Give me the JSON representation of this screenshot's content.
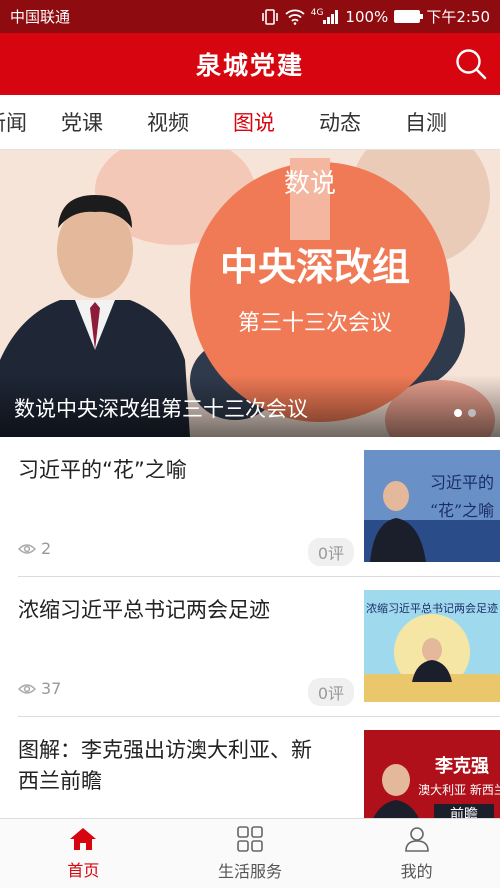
{
  "status_bar": {
    "carrier": "中国联通",
    "battery": "100%",
    "time": "下午2:50",
    "network": "4G"
  },
  "header": {
    "title": "泉城党建",
    "search_icon": "search-icon"
  },
  "tabs": [
    {
      "label": "新闻"
    },
    {
      "label": "党课"
    },
    {
      "label": "视频"
    },
    {
      "label": "图说",
      "active": true
    },
    {
      "label": "动态"
    },
    {
      "label": "自测"
    }
  ],
  "banner": {
    "caption": "数说中央深改组第三十三次会议",
    "bubble_tag": "数说",
    "bubble_title": "中央深改组",
    "bubble_subtitle": "第三十三次会议",
    "slide_count": 2,
    "active_slide": 0
  },
  "news": [
    {
      "title": "习近平的“花”之喻",
      "views": "2",
      "comments": "0评",
      "thumb_text": "习近平的“花”之喻"
    },
    {
      "title": "浓缩习近平总书记两会足迹",
      "views": "37",
      "comments": "0评",
      "thumb_text": "浓缩习近平总书记两会足迹"
    },
    {
      "title": "图解：李克强出访澳大利亚、新西兰前瞻",
      "views": "",
      "comments": "",
      "thumb_text": "李克强出访澳大利亚 新西兰前瞻"
    }
  ],
  "bottom_nav": [
    {
      "label": "首页",
      "icon": "home-icon",
      "active": true
    },
    {
      "label": "生活服务",
      "icon": "grid-icon"
    },
    {
      "label": "我的",
      "icon": "user-icon"
    }
  ],
  "colors": {
    "brand_red": "#d6050f",
    "status_bar": "#8e0b0f"
  }
}
